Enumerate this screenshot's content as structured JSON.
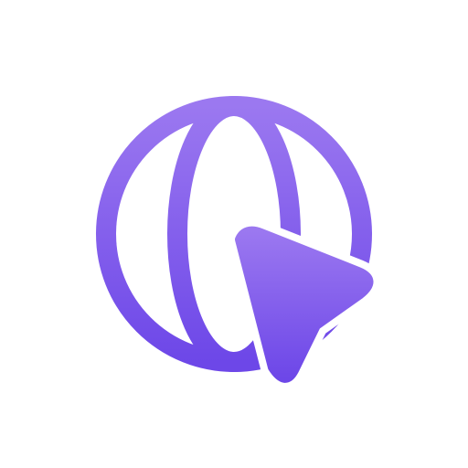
{
  "icon": {
    "name": "globe-cursor-icon",
    "colors": {
      "gradient_start": "#9b78f0",
      "gradient_end": "#6d47e8",
      "background": "#ffffff"
    },
    "parts": [
      "globe-icon",
      "cursor-arrow-icon"
    ]
  }
}
